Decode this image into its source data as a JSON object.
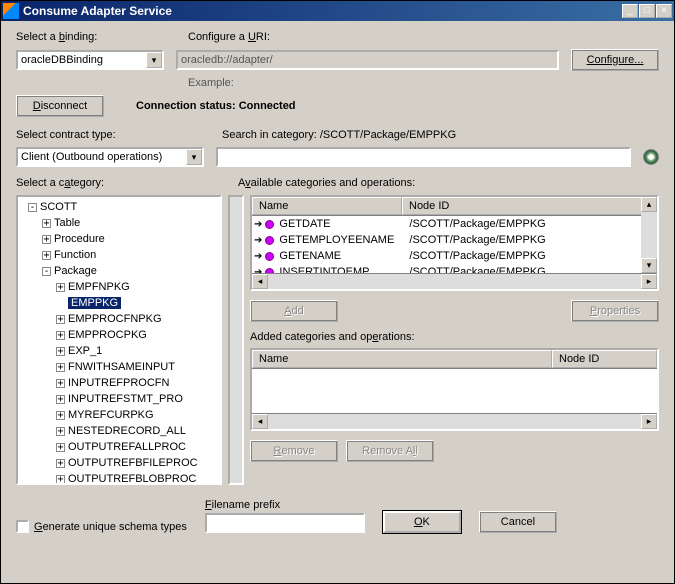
{
  "window": {
    "title": "Consume Adapter Service"
  },
  "labels": {
    "select_binding": "Select a binding:",
    "configure_uri": "Configure a URI:",
    "example": "Example:",
    "connection_status_label": "Connection status:",
    "connection_status_value": "Connected",
    "select_contract": "Select contract type:",
    "search_in_category_label": "Search in category:",
    "search_in_category_path": "/SCOTT/Package/EMPPKG",
    "select_category": "Select a category:",
    "available": "Available categories and operations:",
    "added": "Added categories and operations:",
    "filename_prefix": "Filename prefix"
  },
  "fields": {
    "binding": "oracleDBBinding",
    "uri": "oracledb://adapter/",
    "contract": "Client (Outbound operations)",
    "search_value": "",
    "filename_prefix": ""
  },
  "buttons": {
    "configure": "Configure...",
    "disconnect": "Disconnect",
    "add": "Add",
    "properties": "Properties",
    "remove": "Remove",
    "remove_all": "Remove All",
    "ok": "OK",
    "cancel": "Cancel"
  },
  "checkbox": {
    "generate_unique": "Generate unique schema types"
  },
  "tree": {
    "root": "SCOTT",
    "children": [
      {
        "label": "Table",
        "exp": "+"
      },
      {
        "label": "Procedure",
        "exp": "+"
      },
      {
        "label": "Function",
        "exp": "+"
      },
      {
        "label": "Package",
        "exp": "-",
        "children": [
          {
            "label": "EMPFNPKG",
            "exp": "+"
          },
          {
            "label": "EMPPKG",
            "exp": "",
            "selected": true
          },
          {
            "label": "EMPPROCFNPKG",
            "exp": "+"
          },
          {
            "label": "EMPPROCPKG",
            "exp": "+"
          },
          {
            "label": "EXP_1",
            "exp": "+"
          },
          {
            "label": "FNWITHSAMEINPUT",
            "exp": "+"
          },
          {
            "label": "INPUTREFPROCFN",
            "exp": "+"
          },
          {
            "label": "INPUTREFSTMT_PRO",
            "exp": "+"
          },
          {
            "label": "MYREFCURPKG",
            "exp": "+"
          },
          {
            "label": "NESTEDRECORD_ALL",
            "exp": "+"
          },
          {
            "label": "OUTPUTREFALLPROC",
            "exp": "+"
          },
          {
            "label": "OUTPUTREFBFILEPROC",
            "exp": "+"
          },
          {
            "label": "OUTPUTREFBLOBPROC",
            "exp": "+"
          }
        ]
      }
    ]
  },
  "available_list": {
    "headers": {
      "name": "Name",
      "nodeid": "Node ID"
    },
    "rows": [
      {
        "name": "GETDATE",
        "nodeid": "/SCOTT/Package/EMPPKG"
      },
      {
        "name": "GETEMPLOYEENAME",
        "nodeid": "/SCOTT/Package/EMPPKG"
      },
      {
        "name": "GETENAME",
        "nodeid": "/SCOTT/Package/EMPPKG"
      },
      {
        "name": "INSERTINTOEMP",
        "nodeid": "/SCOTT/Package/EMPPKG"
      }
    ]
  },
  "added_list": {
    "headers": {
      "name": "Name",
      "nodeid": "Node ID"
    },
    "rows": []
  }
}
